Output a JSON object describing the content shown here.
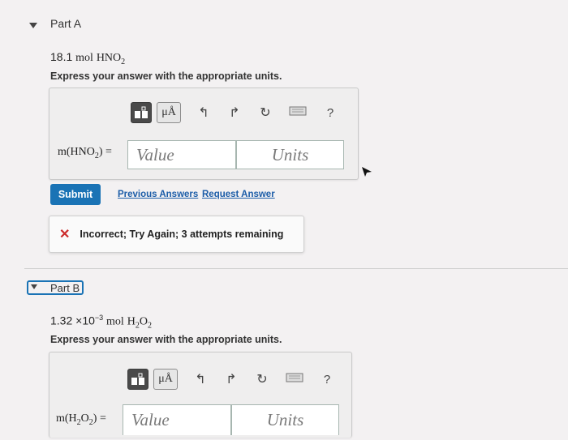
{
  "part_a": {
    "title": "Part A",
    "problem_value": "18.1",
    "problem_unit": "mol",
    "problem_formula_base": "HNO",
    "problem_formula_sub": "2",
    "instruction": "Express your answer with the appropriate units.",
    "toolbar": {
      "units_glyph": "μÅ",
      "undo_glyph": "↰",
      "redo_glyph": "↱",
      "reset_glyph": "↻",
      "help_glyph": "?"
    },
    "eq_prefix": "m(HNO",
    "eq_sub": "2",
    "eq_suffix": ") =",
    "value_placeholder": "Value",
    "units_placeholder": "Units",
    "submit_label": "Submit",
    "previous_answers_label": "Previous Answers",
    "request_answer_label": "Request Answer",
    "feedback_icon": "✕",
    "feedback_text": "Incorrect; Try Again; 3 attempts remaining"
  },
  "part_b": {
    "title": "Part B",
    "problem_value": "1.32 ×10",
    "problem_exp": "−3",
    "problem_unit": "mol",
    "problem_formula_base1": "H",
    "problem_formula_sub1": "2",
    "problem_formula_base2": "O",
    "problem_formula_sub2": "2",
    "instruction": "Express your answer with the appropriate units.",
    "toolbar": {
      "units_glyph": "μÅ",
      "undo_glyph": "↰",
      "redo_glyph": "↱",
      "reset_glyph": "↻",
      "help_glyph": "?"
    },
    "eq_prefix": "m(H",
    "eq_sub1": "2",
    "eq_mid": "O",
    "eq_sub2": "2",
    "eq_suffix": ") =",
    "value_placeholder": "Value",
    "units_placeholder": "Units"
  },
  "colors": {
    "submit_bg": "#1a73b5",
    "link": "#1c5da8",
    "error": "#cc2b2b",
    "focus_outline": "#1a73b5"
  }
}
